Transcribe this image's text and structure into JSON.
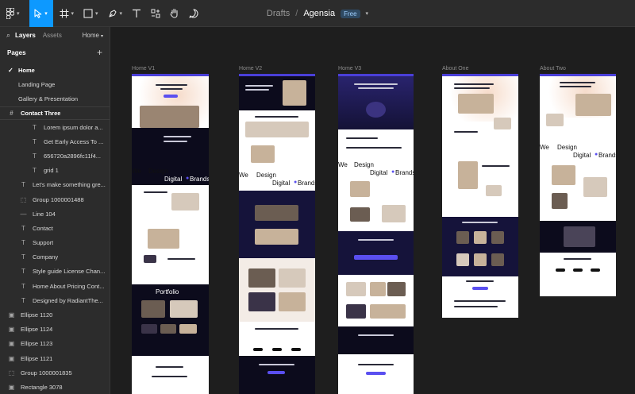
{
  "toolbar": {
    "tools": [
      "main-menu",
      "move",
      "frame",
      "shape",
      "pen",
      "text",
      "resources",
      "hand",
      "comment"
    ],
    "active_tool": "move",
    "breadcrumb_root": "Drafts",
    "breadcrumb_separator": "/",
    "project_name": "Agensia",
    "plan_badge": "Free"
  },
  "sidebar": {
    "tab_layers": "Layers",
    "tab_assets": "Assets",
    "page_dropdown": "Home",
    "pages_title": "Pages",
    "pages": [
      {
        "label": "Home",
        "current": true
      },
      {
        "label": "Landing Page",
        "current": false
      },
      {
        "label": "Gallery & Presentation",
        "current": false
      }
    ],
    "layers": [
      {
        "label": "Contact Three",
        "icon": "frame-icon",
        "selected": true
      },
      {
        "label": "Lorem ipsum dolor a...",
        "icon": "text-icon"
      },
      {
        "label": "Get Early Access To ...",
        "icon": "text-icon"
      },
      {
        "label": "656720a2896fc11f4...",
        "icon": "text-icon"
      },
      {
        "label": "grid 1",
        "icon": "text-icon"
      },
      {
        "label": "Let's make something gre...",
        "icon": "text-icon"
      },
      {
        "label": "Group 1000001488",
        "icon": "group-icon"
      },
      {
        "label": "Line 104",
        "icon": "line-icon"
      },
      {
        "label": "Contact",
        "icon": "text-icon"
      },
      {
        "label": "Support",
        "icon": "text-icon"
      },
      {
        "label": "Company",
        "icon": "text-icon"
      },
      {
        "label": "Style guide License Chan...",
        "icon": "text-icon"
      },
      {
        "label": "Home About Pricing Cont...",
        "icon": "text-icon"
      },
      {
        "label": "Designed by RadiantThe...",
        "icon": "text-icon"
      },
      {
        "label": "Ellipse 1120",
        "icon": "image-icon"
      },
      {
        "label": "Ellipse 1124",
        "icon": "image-icon"
      },
      {
        "label": "Ellipse 1123",
        "icon": "image-icon"
      },
      {
        "label": "Ellipse 1121",
        "icon": "image-icon"
      },
      {
        "label": "Group 1000001835",
        "icon": "group-icon"
      },
      {
        "label": "Rectangle 3078",
        "icon": "image-icon"
      }
    ]
  },
  "canvas": {
    "frames": [
      "Home V1",
      "Home V2",
      "Home V3",
      "About One",
      "About Two"
    ],
    "mockup_text": {
      "we": "We",
      "design": "Design",
      "digital": "Digital",
      "brands": "Brands",
      "portfolio": "Portfolio"
    }
  },
  "colors": {
    "accent": "#0d99ff",
    "panel": "#2c2c2c",
    "canvas": "#1e1e1e",
    "brand_purple": "#4a3fd8"
  }
}
